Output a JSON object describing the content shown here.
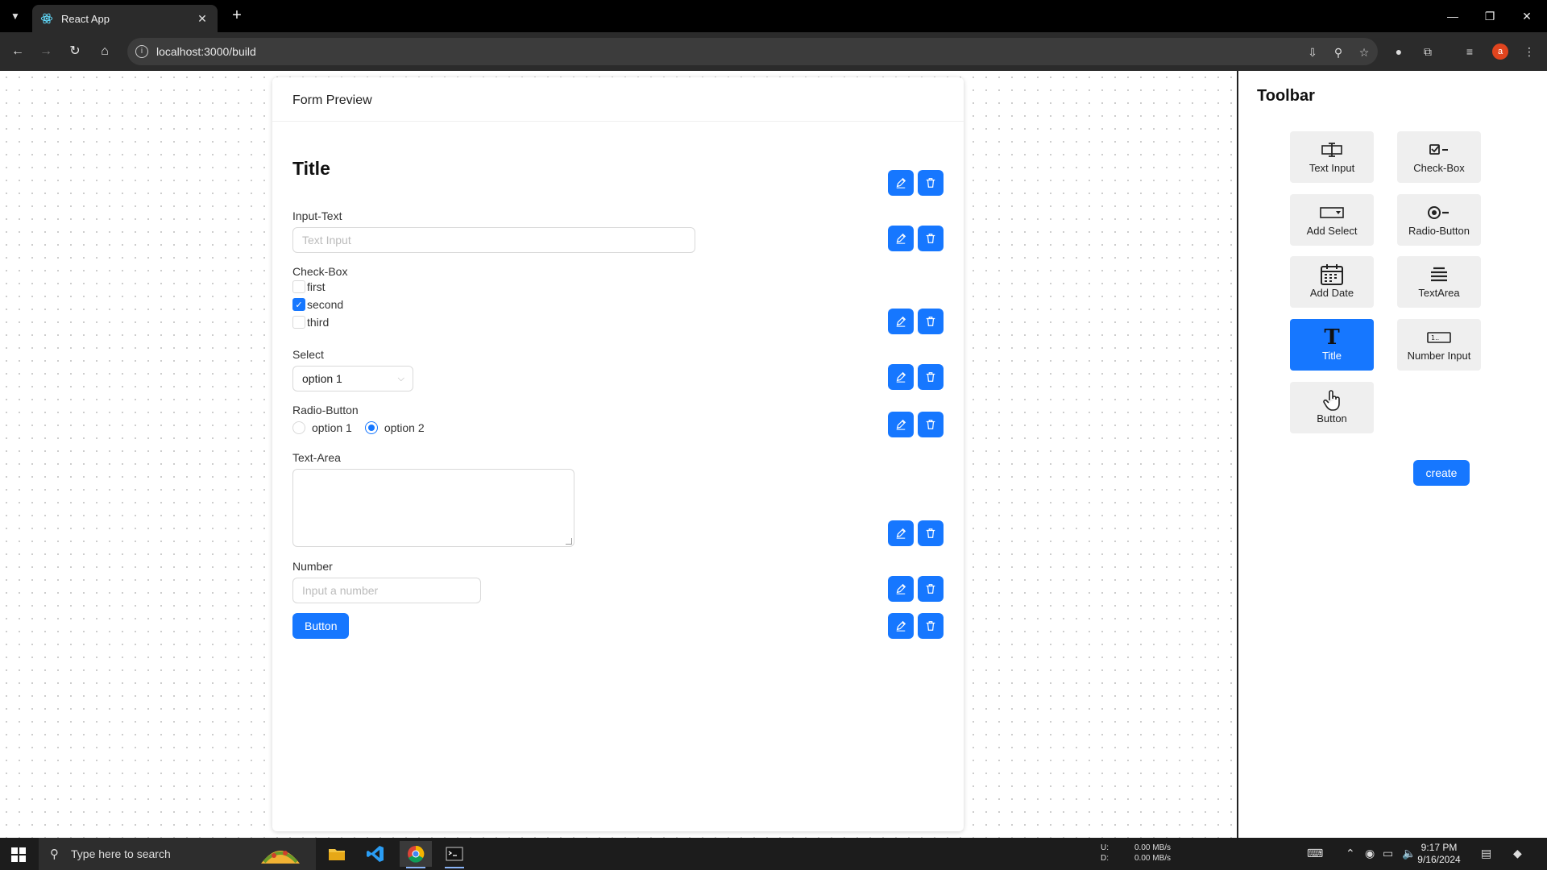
{
  "browser": {
    "tab_title": "React App",
    "url": "localhost:3000/build"
  },
  "form_preview": {
    "header": "Form Preview",
    "title": "Title",
    "input_text": {
      "label": "Input-Text",
      "placeholder": "Text Input"
    },
    "checkbox": {
      "label": "Check-Box",
      "options": [
        {
          "label": "first",
          "checked": false
        },
        {
          "label": "second",
          "checked": true
        },
        {
          "label": "third",
          "checked": false
        }
      ]
    },
    "select": {
      "label": "Select",
      "value": "option 1"
    },
    "radio": {
      "label": "Radio-Button",
      "options": [
        {
          "label": "option 1",
          "checked": false
        },
        {
          "label": "option 2",
          "checked": true
        }
      ]
    },
    "textarea": {
      "label": "Text-Area"
    },
    "number": {
      "label": "Number",
      "placeholder": "Input a number"
    },
    "button_label": "Button"
  },
  "toolbar": {
    "title": "Toolbar",
    "tools": [
      {
        "label": "Text Input",
        "icon": "text-input-icon"
      },
      {
        "label": "Check-Box",
        "icon": "checkbox-icon"
      },
      {
        "label": "Add Select",
        "icon": "select-icon"
      },
      {
        "label": "Radio-Button",
        "icon": "radio-icon"
      },
      {
        "label": "Add Date",
        "icon": "calendar-icon"
      },
      {
        "label": "TextArea",
        "icon": "textarea-icon"
      },
      {
        "label": "Title",
        "icon": "title-icon",
        "active": true
      },
      {
        "label": "Number Input",
        "icon": "number-input-icon"
      },
      {
        "label": "Button",
        "icon": "button-icon"
      }
    ],
    "create_label": "create"
  },
  "taskbar": {
    "search_placeholder": "Type here to search",
    "net_up_label": "U:",
    "net_up": "0.00 MB/s",
    "net_down_label": "D:",
    "net_down": "0.00 MB/s",
    "time": "9:17 PM",
    "date": "9/16/2024"
  },
  "colors": {
    "accent": "#1677ff",
    "chrome_dark": "#2b2b2b",
    "taskbar": "#1c1c1c"
  }
}
